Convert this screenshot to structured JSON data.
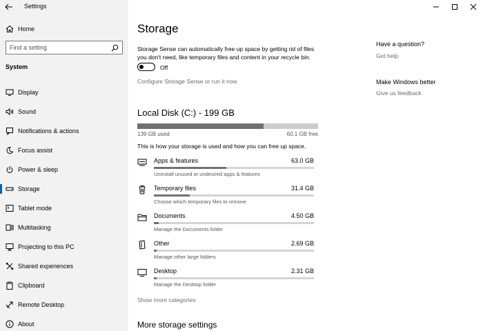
{
  "window": {
    "title": "Settings"
  },
  "sidebar": {
    "home_label": "Home",
    "search_placeholder": "Find a setting",
    "section_label": "System",
    "items": [
      {
        "label": "Display",
        "icon": "display-icon"
      },
      {
        "label": "Sound",
        "icon": "sound-icon"
      },
      {
        "label": "Notifications & actions",
        "icon": "notifications-icon"
      },
      {
        "label": "Focus assist",
        "icon": "moon-icon"
      },
      {
        "label": "Power & sleep",
        "icon": "power-icon"
      },
      {
        "label": "Storage",
        "icon": "storage-icon",
        "selected": true
      },
      {
        "label": "Tablet mode",
        "icon": "tablet-icon"
      },
      {
        "label": "Multitasking",
        "icon": "multitasking-icon"
      },
      {
        "label": "Projecting to this PC",
        "icon": "projecting-icon"
      },
      {
        "label": "Shared experiences",
        "icon": "shared-icon"
      },
      {
        "label": "Clipboard",
        "icon": "clipboard-icon"
      },
      {
        "label": "Remote Desktop",
        "icon": "remote-desktop-icon"
      },
      {
        "label": "About",
        "icon": "info-icon"
      }
    ]
  },
  "main": {
    "title": "Storage",
    "storage_sense_desc": "Storage Sense can automatically free up space by getting rid of files you don't need, like temporary files and content in your recycle bin.",
    "toggle_state": "Off",
    "toggle_on": false,
    "configure_link": "Configure Storage Sense or run it now",
    "disk": {
      "title": "Local Disk (C:) - 199 GB",
      "used_label": "139 GB used",
      "free_label": "60.1 GB free",
      "used_fraction": 0.699,
      "description": "This is how your storage is used and how you can free up space."
    },
    "categories": [
      {
        "name": "Apps & features",
        "size": "63.0 GB",
        "sub": "Uninstall unused or undesired apps & features",
        "fraction": 0.453,
        "icon": "apps-icon"
      },
      {
        "name": "Temporary files",
        "size": "31.4 GB",
        "sub": "Choose which temporary files to remove",
        "fraction": 0.226,
        "icon": "trash-icon"
      },
      {
        "name": "Documents",
        "size": "4.50 GB",
        "sub": "Manage the Documents folder",
        "fraction": 0.032,
        "icon": "documents-icon"
      },
      {
        "name": "Other",
        "size": "2.69 GB",
        "sub": "Manage other large folders",
        "fraction": 0.019,
        "icon": "other-icon"
      },
      {
        "name": "Desktop",
        "size": "2.31 GB",
        "sub": "Manage the Desktop folder",
        "fraction": 0.017,
        "icon": "desktop-icon"
      }
    ],
    "show_more": "Show more categories",
    "more_settings_heading": "More storage settings"
  },
  "help": {
    "question_heading": "Have a question?",
    "get_help": "Get help",
    "better_heading": "Make Windows better",
    "feedback": "Give us feedback"
  },
  "colors": {
    "accent": "#0063b1",
    "sidebar_bg": "#f2f2f2",
    "bar_fill": "#707070",
    "bar_track": "#cccccc"
  }
}
